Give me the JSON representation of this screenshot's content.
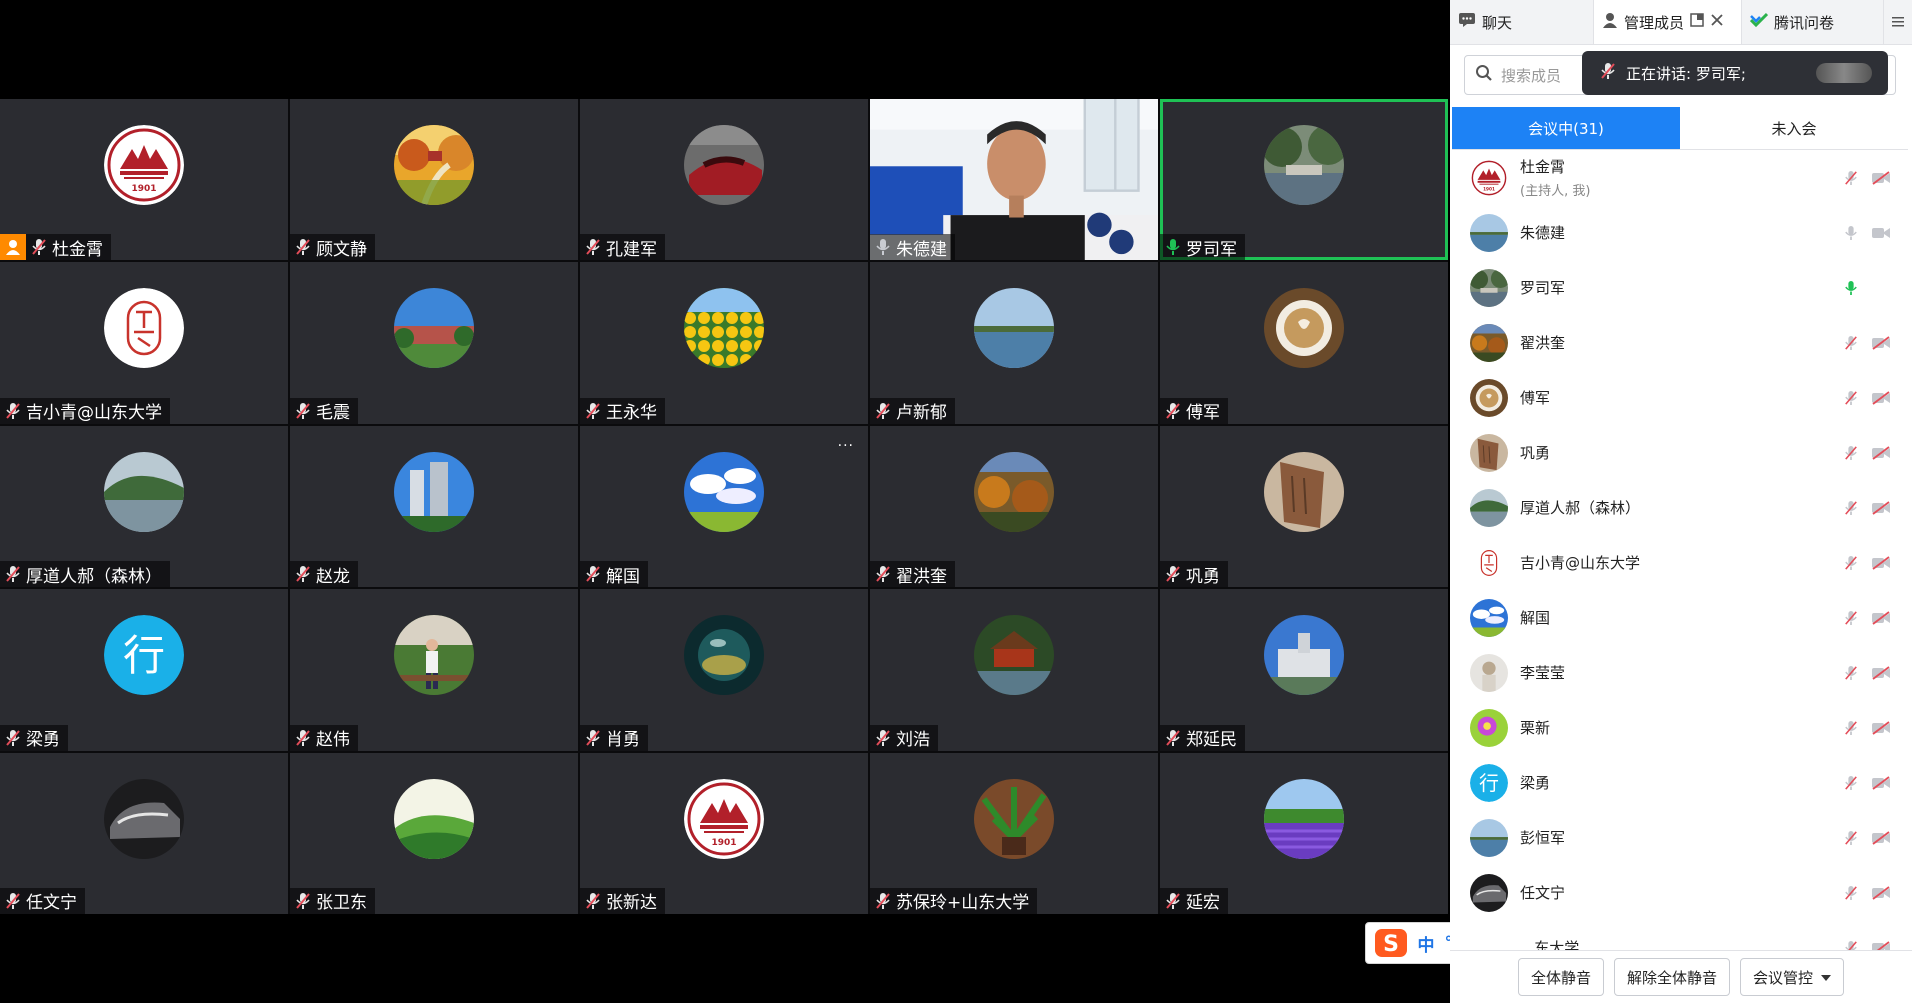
{
  "tiles": [
    {
      "name": "杜金霄",
      "avatar": "sdu-logo",
      "mic": "muted",
      "host": true
    },
    {
      "name": "顾文静",
      "avatar": "autumn-farm",
      "mic": "muted"
    },
    {
      "name": "孔建军",
      "avatar": "red-car",
      "mic": "muted"
    },
    {
      "name": "朱德建",
      "avatar": "video",
      "mic": "on"
    },
    {
      "name": "罗司军",
      "avatar": "canal",
      "mic": "speaking",
      "active": true
    },
    {
      "name": "吉小青@山东大学",
      "avatar": "seal",
      "mic": "muted"
    },
    {
      "name": "毛震",
      "avatar": "campus",
      "mic": "muted"
    },
    {
      "name": "王永华",
      "avatar": "sunflowers",
      "mic": "muted"
    },
    {
      "name": "卢新郁",
      "avatar": "lake",
      "mic": "muted"
    },
    {
      "name": "傅军",
      "avatar": "coffee",
      "mic": "muted"
    },
    {
      "name": "厚道人郝（森林）",
      "avatar": "river",
      "mic": "muted"
    },
    {
      "name": "赵龙",
      "avatar": "tower",
      "mic": "muted"
    },
    {
      "name": "解国",
      "avatar": "sky",
      "mic": "muted",
      "more": true
    },
    {
      "name": "翟洪奎",
      "avatar": "autumn-hills",
      "mic": "muted"
    },
    {
      "name": "巩勇",
      "avatar": "stone",
      "mic": "muted"
    },
    {
      "name": "梁勇",
      "avatar": "xing",
      "mic": "muted"
    },
    {
      "name": "赵伟",
      "avatar": "person-garden",
      "mic": "muted"
    },
    {
      "name": "肖勇",
      "avatar": "bubble",
      "mic": "muted"
    },
    {
      "name": "刘浩",
      "avatar": "pavilion",
      "mic": "muted"
    },
    {
      "name": "郑延民",
      "avatar": "building",
      "mic": "muted"
    },
    {
      "name": "任文宁",
      "avatar": "car-dark",
      "mic": "muted"
    },
    {
      "name": "张卫东",
      "avatar": "green-hill",
      "mic": "muted"
    },
    {
      "name": "张新达",
      "avatar": "sdu-logo",
      "mic": "muted"
    },
    {
      "name": "苏保玲+山东大学",
      "avatar": "plant",
      "mic": "muted"
    },
    {
      "name": "延宏",
      "avatar": "lavender",
      "mic": "muted"
    }
  ],
  "logo_text": "1901",
  "xing_char": "行",
  "more_dots": "···",
  "tabs": {
    "chat": "聊天",
    "members": "管理成员",
    "survey": "腾讯问卷"
  },
  "search": {
    "placeholder": "搜索成员"
  },
  "speaking": {
    "label": "正在讲话: 罗司军;"
  },
  "segments": {
    "in_meeting": "会议中(31)",
    "not_joined": "未入会"
  },
  "members": [
    {
      "name": "杜金霄",
      "sub": "(主持人, 我)",
      "avatar": "sdu-logo",
      "mic": "muted",
      "cam": "off"
    },
    {
      "name": "朱德建",
      "avatar": "lake",
      "mic": "on",
      "cam": "on"
    },
    {
      "name": "罗司军",
      "avatar": "canal",
      "mic": "speaking",
      "cam": "none"
    },
    {
      "name": "翟洪奎",
      "avatar": "autumn-hills",
      "mic": "muted",
      "cam": "off"
    },
    {
      "name": "傅军",
      "avatar": "coffee",
      "mic": "muted",
      "cam": "off"
    },
    {
      "name": "巩勇",
      "avatar": "stone",
      "mic": "muted",
      "cam": "off"
    },
    {
      "name": "厚道人郝（森林）",
      "avatar": "river",
      "mic": "muted",
      "cam": "off"
    },
    {
      "name": "吉小青@山东大学",
      "avatar": "seal",
      "mic": "muted",
      "cam": "off"
    },
    {
      "name": "解国",
      "avatar": "sky",
      "mic": "muted",
      "cam": "off"
    },
    {
      "name": "李莹莹",
      "avatar": "woman",
      "mic": "muted",
      "cam": "off"
    },
    {
      "name": "栗新",
      "avatar": "flower",
      "mic": "muted",
      "cam": "off"
    },
    {
      "name": "梁勇",
      "avatar": "xing",
      "mic": "muted",
      "cam": "off"
    },
    {
      "name": "彭恒军",
      "avatar": "lake",
      "mic": "muted",
      "cam": "off"
    },
    {
      "name": "任文宁",
      "avatar": "car-dark",
      "mic": "muted",
      "cam": "off"
    },
    {
      "name": "...东大学",
      "avatar": "none",
      "mic": "muted",
      "cam": "off"
    }
  ],
  "bottom": {
    "mute_all": "全体静音",
    "unmute_all": "解除全体静音",
    "control": "会议管控"
  },
  "ime": {
    "lang": "中",
    "punct": "°,"
  },
  "colors": {
    "accent": "#1d82f5",
    "speaking": "#1fc155",
    "muted": "#e34d59",
    "host": "#ff8a00"
  }
}
